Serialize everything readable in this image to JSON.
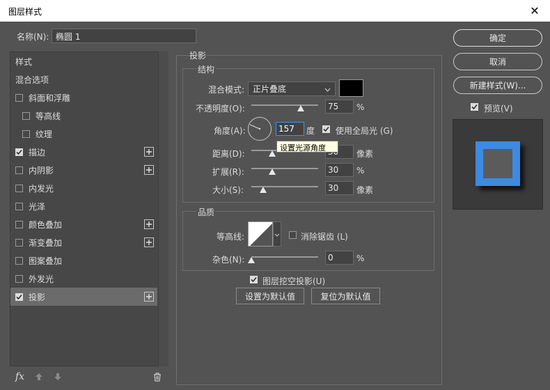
{
  "window": {
    "title": "图层样式",
    "close": "✕"
  },
  "name_row": {
    "label": "名称(N):",
    "value": "椭圆 1"
  },
  "style_list": {
    "header": "样式",
    "blend_options": "混合选项",
    "items": [
      {
        "label": "斜面和浮雕",
        "checked": false,
        "plus": false,
        "indent": false
      },
      {
        "label": "等高线",
        "checked": false,
        "plus": false,
        "indent": true
      },
      {
        "label": "纹理",
        "checked": false,
        "plus": false,
        "indent": true
      },
      {
        "label": "描边",
        "checked": true,
        "plus": true,
        "indent": false
      },
      {
        "label": "内阴影",
        "checked": false,
        "plus": true,
        "indent": false
      },
      {
        "label": "内发光",
        "checked": false,
        "plus": false,
        "indent": false
      },
      {
        "label": "光泽",
        "checked": false,
        "plus": false,
        "indent": false
      },
      {
        "label": "颜色叠加",
        "checked": false,
        "plus": true,
        "indent": false
      },
      {
        "label": "渐变叠加",
        "checked": false,
        "plus": true,
        "indent": false
      },
      {
        "label": "图案叠加",
        "checked": false,
        "plus": false,
        "indent": false
      },
      {
        "label": "外发光",
        "checked": false,
        "plus": false,
        "indent": false
      },
      {
        "label": "投影",
        "checked": true,
        "plus": true,
        "indent": false,
        "selected": true
      }
    ],
    "fx_label": "fx"
  },
  "drop_shadow": {
    "section_title": "投影",
    "structure": {
      "title": "结构",
      "blend_mode_label": "混合模式:",
      "blend_mode_value": "正片叠底",
      "shadow_color": "#000000",
      "opacity_label": "不透明度(O):",
      "opacity_value": "75",
      "opacity_unit": "%",
      "angle_label": "角度(A):",
      "angle_value": "157",
      "angle_unit": "度",
      "use_global_light_label": "使用全局光 (G)",
      "use_global_light_checked": true,
      "tooltip": "设置光源角度",
      "distance_label": "距离(D):",
      "distance_value": "30",
      "distance_unit": "像素",
      "spread_label": "扩展(R):",
      "spread_value": "30",
      "spread_unit": "%",
      "size_label": "大小(S):",
      "size_value": "30",
      "size_unit": "像素"
    },
    "quality": {
      "title": "品质",
      "contour_label": "等高线:",
      "anti_alias_label": "消除锯齿 (L)",
      "anti_alias_checked": false,
      "noise_label": "杂色(N):",
      "noise_value": "0",
      "noise_unit": "%"
    },
    "knockout_label": "图层挖空投影(U)",
    "knockout_checked": true,
    "make_default": "设置为默认值",
    "reset_default": "复位为默认值"
  },
  "right": {
    "ok": "确定",
    "cancel": "取消",
    "new_style": "新建样式(W)...",
    "preview_label": "预览(V)",
    "preview_checked": true,
    "preview_color": "#3d8be0"
  }
}
